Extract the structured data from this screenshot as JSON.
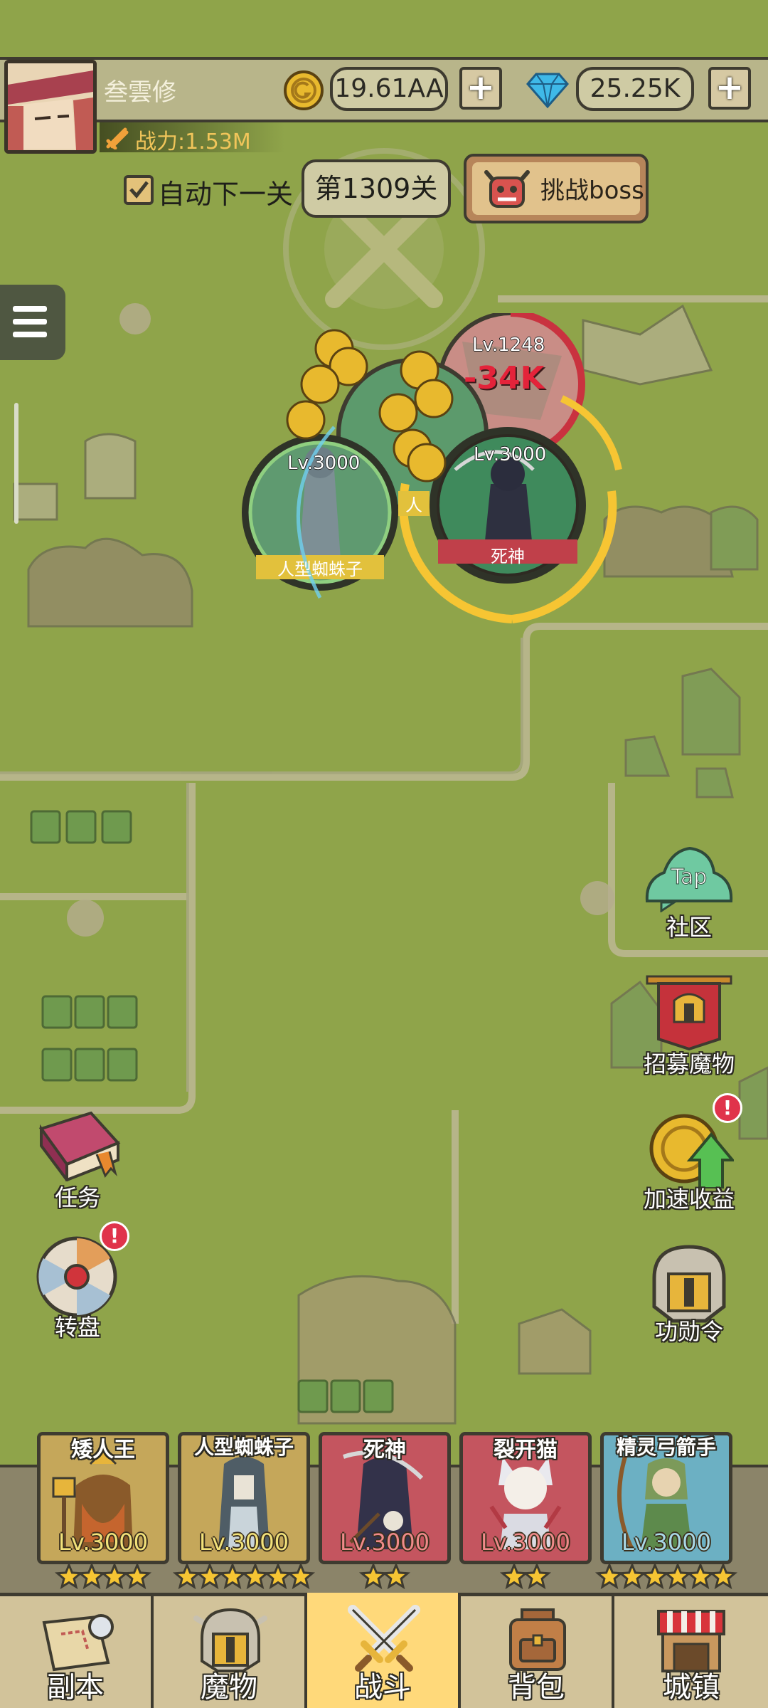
{
  "player": {
    "name": "叁雲修",
    "power": "战力:1.53M"
  },
  "resources": {
    "gold": "19.61AA",
    "gems": "25.25K",
    "plus": "+"
  },
  "stage": {
    "auto_next_label": "自动下一关",
    "current": "第1309关",
    "boss_button": "挑战boss"
  },
  "battle": {
    "enemy": {
      "level": "Lv.1248",
      "damage": "-34K"
    },
    "units": [
      {
        "level": "Lv.3000",
        "name": "人型蜘蛛子"
      },
      {
        "level": "Lv.3000",
        "name": "死神"
      },
      {
        "partial_name": "人"
      }
    ]
  },
  "side_buttons": {
    "community": {
      "label": "社区",
      "icon_text": "Tap"
    },
    "recruit": {
      "label": "招募魔物"
    },
    "quest": {
      "label": "任务"
    },
    "boost": {
      "label": "加速收益",
      "badge": "!"
    },
    "wheel": {
      "label": "转盘",
      "badge": "!"
    },
    "merit": {
      "label": "功勋令"
    }
  },
  "team": [
    {
      "name": "矮人王",
      "level": "Lv.3000",
      "stars": 4,
      "color": "#b59a4c"
    },
    {
      "name": "人型蜘蛛子",
      "level": "Lv.3000",
      "stars": 6,
      "color": "#b59a4c"
    },
    {
      "name": "死神",
      "level": "Lv.3000",
      "stars": 2,
      "color": "#c1535d"
    },
    {
      "name": "裂开猫",
      "level": "Lv.3000",
      "stars": 2,
      "color": "#c1535d"
    },
    {
      "name": "精灵弓箭手",
      "level": "Lv.3000",
      "stars": 6,
      "color": "#5ea0b5"
    }
  ],
  "nav": [
    {
      "label": "副本",
      "icon": "map-scroll-icon"
    },
    {
      "label": "魔物",
      "icon": "knight-helmet-icon"
    },
    {
      "label": "战斗",
      "icon": "crossed-swords-icon",
      "active": true
    },
    {
      "label": "背包",
      "icon": "backpack-icon"
    },
    {
      "label": "城镇",
      "icon": "shop-icon"
    }
  ],
  "colors": {
    "map_bg": "#8fa44a",
    "map_line": "#c9c6a5",
    "active_tab": "#ffd97a",
    "gold": "#e8b92e"
  }
}
